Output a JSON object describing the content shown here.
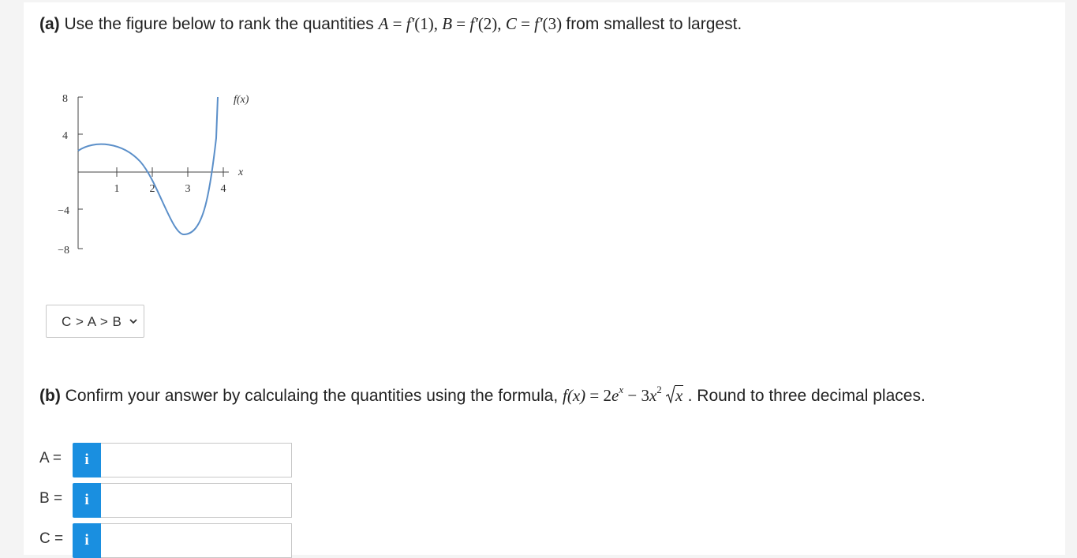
{
  "part_a": {
    "label": "(a)",
    "text_before": "Use the figure below to rank the quantities",
    "math": {
      "A": "A",
      "B": "B",
      "C": "C",
      "eq": "=",
      "fprime": "f′",
      "arg1": "(1),",
      "arg2": "(2),",
      "arg3": "(3)"
    },
    "text_after": "from smallest to largest."
  },
  "figure": {
    "curve_label": "f(x)",
    "x_axis_label": "x",
    "y_ticks": [
      "8",
      "4",
      "−4",
      "−8"
    ],
    "x_ticks": [
      "1",
      "2",
      "3",
      "4"
    ]
  },
  "ranking_select": {
    "selected": "C > A > B"
  },
  "part_b": {
    "label": "(b)",
    "text_before": "Confirm your answer by calculaing the quantities using the formula,",
    "formula": {
      "lhs": "f(x)",
      "eq": "=",
      "term1_coef": "2",
      "term1_base": "e",
      "term1_exp": "x",
      "minus": "−",
      "term2_coef": "3",
      "term2_base": "x",
      "term2_exp": "2",
      "radicand": "x"
    },
    "text_after": ". Round to three decimal places."
  },
  "answers": [
    {
      "label": "A =",
      "info": "i",
      "value": ""
    },
    {
      "label": "B =",
      "info": "i",
      "value": ""
    },
    {
      "label": "C =",
      "info": "i",
      "value": ""
    }
  ],
  "colors": {
    "curve": "#5b8fc9",
    "info_button": "#1a8fe0"
  }
}
